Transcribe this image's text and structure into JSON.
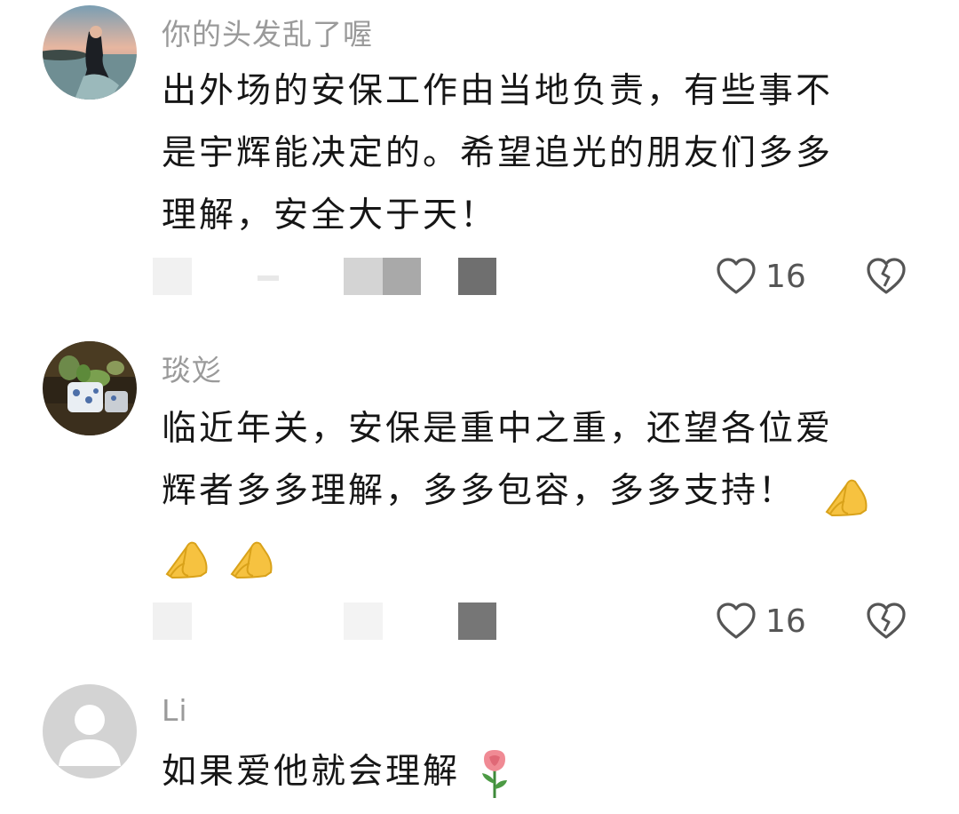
{
  "comments": [
    {
      "username": "你的头发乱了喔",
      "lines": [
        "出外场的安保工作由当地负责，有些事不",
        "是宇辉能决定的。希望追光的朋友们多多",
        "理解，安全大于天！"
      ],
      "likes": "16",
      "avatar": "woman-by-lake-avatar"
    },
    {
      "username": "琰彣",
      "lines": [
        "临近年关，安保是重中之重，还望各位爱",
        "辉者多多理解，多多包容，多多支持！"
      ],
      "emoji_name": "folded-hands-emoji",
      "likes": "16",
      "avatar": "plant-pot-avatar"
    },
    {
      "username": "Li",
      "lines": [
        "如果爱他就会理解"
      ],
      "emoji_name": "rose-emoji",
      "avatar": "default-user-avatar"
    }
  ],
  "colors": {
    "username": "#9a9a9a",
    "text": "#161616",
    "icon": "#555555"
  }
}
